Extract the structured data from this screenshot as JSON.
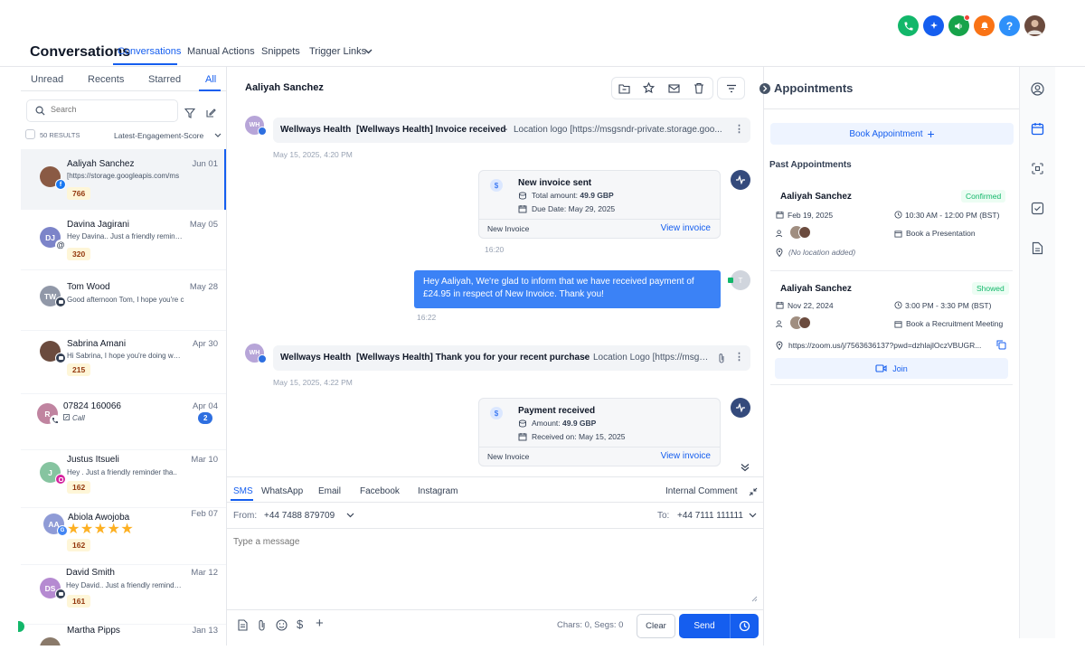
{
  "header": {
    "title": "Conversations",
    "tabs": [
      "Conversations",
      "Manual Actions",
      "Snippets",
      "Trigger Links"
    ],
    "colors": {
      "phone": "#12b76a",
      "ai": "#155eef",
      "announce": "#16a34a",
      "bell": "#f97316",
      "help": "#2e90fa"
    }
  },
  "sidebar": {
    "tabs": [
      "Unread",
      "Recents",
      "Starred",
      "All"
    ],
    "search_placeholder": "Search",
    "results_label": "50 RESULTS",
    "sort_label": "Latest-Engagement-Score",
    "conversations": [
      {
        "name": "Aaliyah Sanchez",
        "date": "Jun 01",
        "preview": "[https://storage.googleapis.com/ms",
        "count": "766",
        "initials": "",
        "avatar_color": "#8a5a44",
        "channel": "facebook"
      },
      {
        "name": "Davina Jagirani",
        "date": "May 05",
        "preview": "Hey Davina.. Just a friendly remind..",
        "count": "320",
        "initials": "DJ",
        "avatar_color": "#7c84c9",
        "channel": "email"
      },
      {
        "name": "Tom Wood",
        "date": "May 28",
        "preview": "Good afternoon Tom, I hope you're c",
        "count": "",
        "initials": "TW",
        "avatar_color": "#9198a8",
        "channel": "sms"
      },
      {
        "name": "Sabrina Amani",
        "date": "Apr 30",
        "preview": "Hi Sabrina, I hope you're doing well..",
        "count": "215",
        "initials": "",
        "avatar_color": "#6b4b3e",
        "channel": "sms"
      },
      {
        "name": "07824 160066",
        "date": "Apr 04",
        "preview": "Call",
        "count": "2",
        "initials": "R",
        "avatar_color": "#c084a0",
        "channel": "phone"
      },
      {
        "name": "Justus Itsueli",
        "date": "Mar 10",
        "preview": "Hey . Just a friendly reminder tha..",
        "count": "162",
        "initials": "J",
        "avatar_color": "#86c4a0",
        "channel": "instagram"
      },
      {
        "name": "Abiola Awojoba",
        "date": "Feb 07",
        "preview": "",
        "count": "162",
        "initials": "AA",
        "avatar_color": "#8f9bd6",
        "channel": "google",
        "stars": "★★★★★"
      },
      {
        "name": "David Smith",
        "date": "Mar 12",
        "preview": "Hey David.. Just a friendly reminder..",
        "count": "161",
        "initials": "DS",
        "avatar_color": "#b58ad1",
        "channel": "sms"
      },
      {
        "name": "Martha Pipps",
        "date": "Jan 13",
        "preview": "",
        "count": "",
        "initials": "",
        "avatar_color": "#8a7a6a",
        "channel": ""
      }
    ]
  },
  "thread": {
    "contact_name": "Aaliyah Sanchez",
    "messages": {
      "m1": {
        "sender": "Wellways Health",
        "subject": "[Wellways Health] Invoice received",
        "snippet": "Location logo [https://msgsndr-private.storage.goo...",
        "time": "May 15, 2025, 4:20 PM",
        "avatar": "WH"
      },
      "card1": {
        "title": "New invoice sent",
        "line1_label": "Total amount: ",
        "line1_value": "49.9 GBP",
        "line2_label": "Due Date: ",
        "line2_value": "May 29, 2025",
        "footer": "New Invoice",
        "link": "View invoice",
        "time": "16:20"
      },
      "sms": {
        "text": "Hey Aaliyah, We're glad to inform that we have received payment of £24.95 in respect of New Invoice. Thank you!",
        "time": "16:22"
      },
      "m2": {
        "sender": "Wellways Health",
        "subject": "[Wellways Health] Thank you for your recent purchase",
        "snippet": "Location Logo [https://msgs...",
        "time": "May 15, 2025, 4:22 PM",
        "avatar": "WH"
      },
      "card2": {
        "title": "Payment received",
        "line1_label": "Amount: ",
        "line1_value": "49.9 GBP",
        "line2_label": "Received on: ",
        "line2_value": "May 15, 2025",
        "footer": "New Invoice",
        "link": "View invoice"
      }
    }
  },
  "composer": {
    "tabs": [
      "SMS",
      "WhatsApp",
      "Email",
      "Facebook",
      "Instagram"
    ],
    "internal_comment": "Internal Comment",
    "from_label": "From:",
    "from_value": "+44 7488 879709",
    "to_label": "To:",
    "to_value": "+44 7111 111111",
    "placeholder": "Type a message",
    "counter": "Chars: 0, Segs: 0",
    "clear_label": "Clear",
    "send_label": "Send"
  },
  "appointments": {
    "title": "Appointments",
    "book_label": "Book Appointment",
    "past_label": "Past Appointments",
    "items": [
      {
        "name": "Aaliyah Sanchez",
        "status": "Confirmed",
        "date": "Feb 19, 2025",
        "time": "10:30 AM - 12:00 PM (BST)",
        "calendar": "Book a Presentation",
        "location": "(No location added)"
      },
      {
        "name": "Aaliyah Sanchez",
        "status": "Showed",
        "date": "Nov 22, 2024",
        "time": "3:00 PM - 3:30 PM (BST)",
        "calendar": "Book a Recruitment Meeting",
        "location": "https://zoom.us/j/7563636137?pwd=dzhlajlOczVBUGR...",
        "join_label": "Join"
      }
    ]
  }
}
